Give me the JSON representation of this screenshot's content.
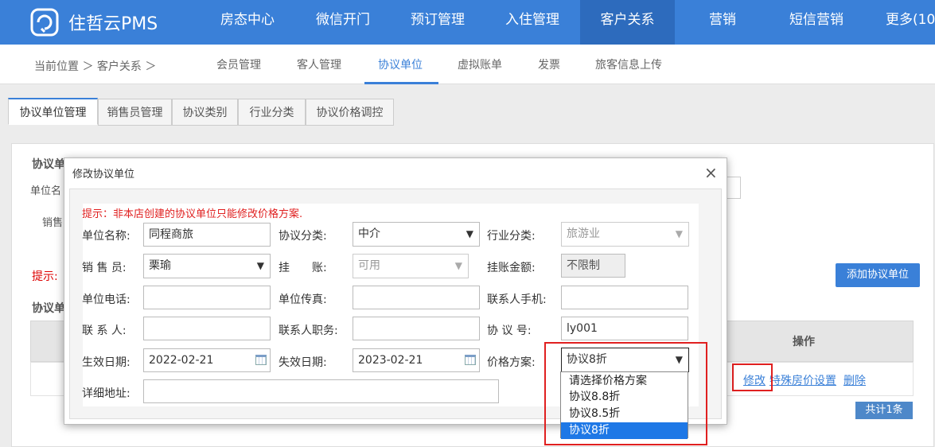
{
  "app": {
    "brand": "住哲云PMS"
  },
  "nav": [
    {
      "label": "房态中心"
    },
    {
      "label": "微信开门"
    },
    {
      "label": "预订管理"
    },
    {
      "label": "入住管理"
    },
    {
      "label": "客户关系",
      "active": true
    },
    {
      "label": "营销"
    },
    {
      "label": "短信营销"
    },
    {
      "label": "更多(10)"
    }
  ],
  "breadcrumb": "当前位置 ＞ 客户关系 ＞",
  "subtabs": [
    {
      "label": "会员管理"
    },
    {
      "label": "客人管理"
    },
    {
      "label": "协议单位",
      "active": true
    },
    {
      "label": "虚拟账单"
    },
    {
      "label": "发票"
    },
    {
      "label": "旅客信息上传"
    }
  ],
  "pagetabs": [
    {
      "label": "协议单位管理",
      "active": true
    },
    {
      "label": "销售员管理"
    },
    {
      "label": "协议类别"
    },
    {
      "label": "行业分类"
    },
    {
      "label": "协议价格调控"
    }
  ],
  "background": {
    "fieldset1": "协议单",
    "label_unit": "单位名",
    "label_sales": "销售",
    "hint": "提示:",
    "fieldset2": "协议单",
    "add_button": "添加协议单位",
    "col_action": "操作",
    "row_edit": "修改",
    "row_special": "特殊房价设置",
    "row_delete": "删除",
    "total": "共计1条"
  },
  "modal": {
    "title": "修改协议单位",
    "close": "×",
    "tip": "提示：非本店创建的协议单位只能修改价格方案.",
    "fields": {
      "unit_name": {
        "label": "单位名称:",
        "value": "同程商旅"
      },
      "category": {
        "label": "协议分类:",
        "value": "中介"
      },
      "industry": {
        "label": "行业分类:",
        "value": "旅游业"
      },
      "salesperson": {
        "label": "销 售 员:",
        "value": "栗瑜"
      },
      "credit": {
        "label": "挂　　账:",
        "value": "可用"
      },
      "credit_amount": {
        "label": "挂账金额:",
        "value": "不限制"
      },
      "phone": {
        "label": "单位电话:",
        "value": ""
      },
      "fax": {
        "label": "单位传真:",
        "value": ""
      },
      "contact_mobile": {
        "label": "联系人手机:",
        "value": ""
      },
      "contact": {
        "label": "联 系 人:",
        "value": ""
      },
      "contact_title": {
        "label": "联系人职务:",
        "value": ""
      },
      "agreement_no": {
        "label": "协 议 号:",
        "value": "ly001"
      },
      "start_date": {
        "label": "生效日期:",
        "value": "2022-02-21"
      },
      "end_date": {
        "label": "失效日期:",
        "value": "2023-02-21"
      },
      "price_plan": {
        "label": "价格方案:",
        "value": "协议8折"
      },
      "address": {
        "label": "详细地址:",
        "value": ""
      }
    },
    "price_plan_options": [
      {
        "label": "请选择价格方案"
      },
      {
        "label": "协议8.8折"
      },
      {
        "label": "协议8.5折"
      },
      {
        "label": "协议8折",
        "selected": true
      }
    ]
  },
  "colors": {
    "nav_bg": "#3a80d8",
    "nav_active": "#2d6bbd",
    "highlight": "#e02020",
    "selected_option": "#1e78e6"
  }
}
